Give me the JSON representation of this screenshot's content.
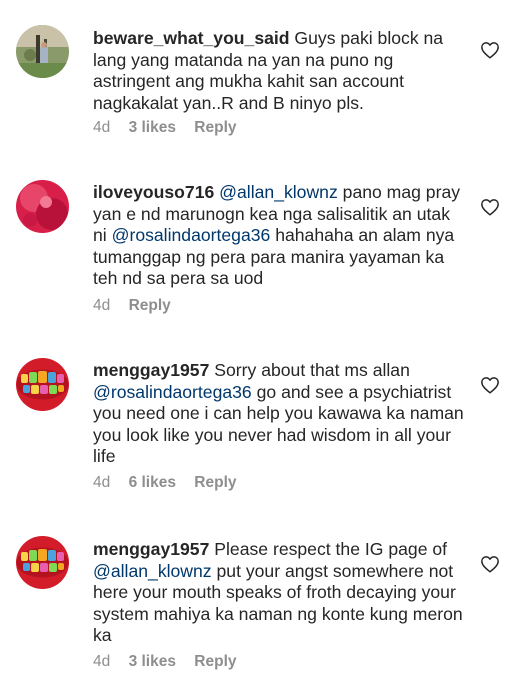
{
  "comments": [
    {
      "username": "beware_what_you_said",
      "text_parts": [
        {
          "type": "text",
          "value": " Guys paki block na lang yang matanda na yan na puno ng astringent ang mukha kahit san account nagkakalat yan..R and B ninyo pls."
        }
      ],
      "time": "4d",
      "likes": "3 likes",
      "reply": "Reply",
      "avatar_icon": "outdoor-photo-avatar"
    },
    {
      "username": "iloveyouso716",
      "text_parts": [
        {
          "type": "text",
          "value": " "
        },
        {
          "type": "mention",
          "value": "@allan_klownz"
        },
        {
          "type": "text",
          "value": " pano mag pray yan e nd marunogn kea nga salisalitik an utak ni "
        },
        {
          "type": "mention",
          "value": "@rosalindaortega36"
        },
        {
          "type": "text",
          "value": " hahahaha an alam nya tumanggap ng pera para manira yayaman ka teh nd sa pera sa uod"
        }
      ],
      "time": "4d",
      "likes": "",
      "reply": "Reply",
      "avatar_icon": "red-pattern-avatar"
    },
    {
      "username": "menggay1957",
      "text_parts": [
        {
          "type": "text",
          "value": " Sorry about that ms allan "
        },
        {
          "type": "mention",
          "value": "@rosalindaortega36"
        },
        {
          "type": "text",
          "value": " go and see a psychiatrist you need one i can help you kawawa ka naman you look like you never had wisdom in all your life"
        }
      ],
      "time": "4d",
      "likes": "6 likes",
      "reply": "Reply",
      "avatar_icon": "colorful-teeth-avatar"
    },
    {
      "username": "menggay1957",
      "text_parts": [
        {
          "type": "text",
          "value": " Please respect the IG page of "
        },
        {
          "type": "mention",
          "value": "@allan_klownz"
        },
        {
          "type": "text",
          "value": " put your angst somewhere not here your mouth speaks of froth decaying your system mahiya ka naman ng konte kung meron ka"
        }
      ],
      "time": "4d",
      "likes": "3 likes",
      "reply": "Reply",
      "avatar_icon": "colorful-teeth-avatar"
    }
  ],
  "icons": {
    "like": "heart-outline-icon"
  },
  "colors": {
    "text": "#262626",
    "mention": "#00376b",
    "meta": "#8e8e8e"
  }
}
